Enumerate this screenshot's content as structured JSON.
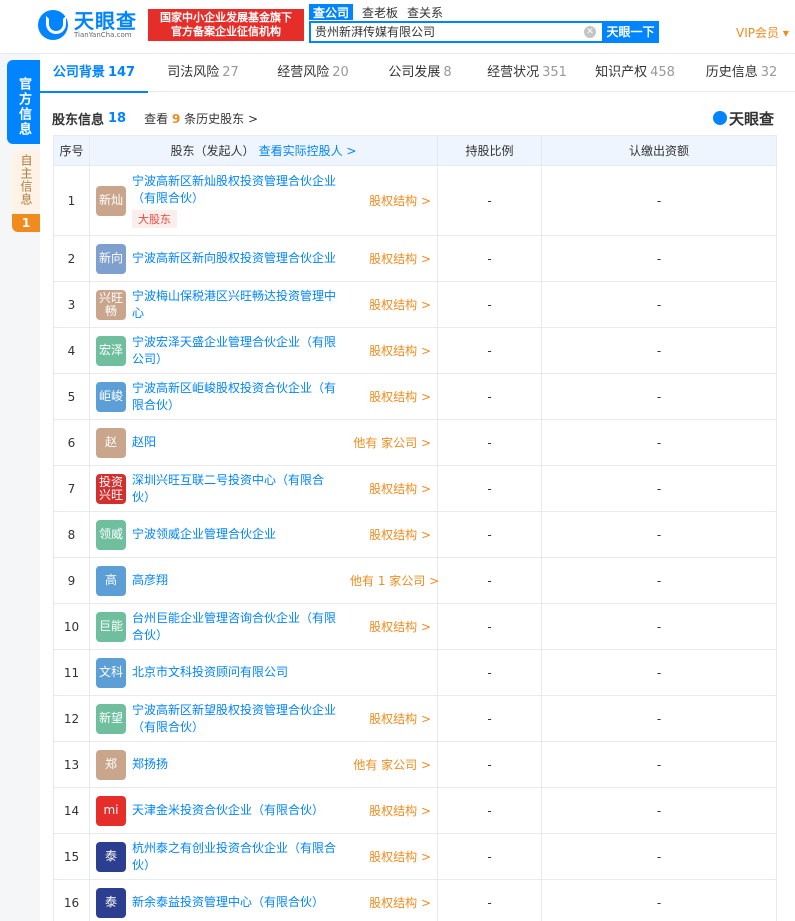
{
  "header": {
    "logo_cn": "天眼查",
    "logo_en": "TianYanCha.com",
    "badge_line1": "国家中小企业发展基金旗下",
    "badge_line2": "官方备案企业征信机构",
    "search_tabs": [
      "查公司",
      "查老板",
      "查关系"
    ],
    "search_value": "贵州新湃传媒有限公司",
    "search_button": "天眼一下",
    "vip": "VIP会员"
  },
  "side_tabs": {
    "official": "官方信息",
    "self": "自主信息",
    "self_count": "1"
  },
  "topnav": [
    {
      "label": "公司背景",
      "count": "147"
    },
    {
      "label": "司法风险",
      "count": "27"
    },
    {
      "label": "经营风险",
      "count": "20"
    },
    {
      "label": "公司发展",
      "count": "8"
    },
    {
      "label": "经营状况",
      "count": "351"
    },
    {
      "label": "知识产权",
      "count": "458"
    },
    {
      "label": "历史信息",
      "count": "32"
    }
  ],
  "section": {
    "title": "股东信息",
    "count": "18",
    "hist_prefix": "查看",
    "hist_count": "9",
    "hist_suffix": "条历史股东 >",
    "brand": "天眼查"
  },
  "table": {
    "headers": {
      "idx": "序号",
      "name": "股东（发起人）",
      "name_link": "查看实际控股人 >",
      "ratio": "持股比例",
      "money": "认缴出资额"
    },
    "rows": [
      {
        "idx": "1",
        "avatar": "新灿",
        "color": "#c9a58c",
        "name": "宁波高新区新灿股权投资管理合伙企业（有限合伙）",
        "tag": "大股东",
        "side": "股权结构 >",
        "ratio": "-",
        "money": "-"
      },
      {
        "idx": "2",
        "avatar": "新向",
        "color": "#7f9fcf",
        "name": "宁波高新区新向股权投资管理合伙企业",
        "side": "股权结构 >",
        "ratio": "-",
        "money": "-"
      },
      {
        "idx": "3",
        "avatar": "兴旺畅",
        "color": "#c9a58c",
        "name": "宁波梅山保税港区兴旺畅达投资管理中心",
        "side": "股权结构 >",
        "ratio": "-",
        "money": "-"
      },
      {
        "idx": "4",
        "avatar": "宏泽",
        "color": "#6fbf9f",
        "name": "宁波宏泽天盛企业管理合伙企业（有限公司）",
        "side": "股权结构 >",
        "ratio": "-",
        "money": "-"
      },
      {
        "idx": "5",
        "avatar": "岠峻",
        "color": "#5c9fd6",
        "name": "宁波高新区岠峻股权投资合伙企业（有限合伙）",
        "side": "股权结构 >",
        "ratio": "-",
        "money": "-"
      },
      {
        "idx": "6",
        "avatar": "赵",
        "color": "#c9a58c",
        "name": "赵阳",
        "side": "他有 家公司 >",
        "ratio": "-",
        "money": "-"
      },
      {
        "idx": "7",
        "avatar": "投资兴旺",
        "color": "#d32f2f",
        "name": "深圳兴旺互联二号投资中心（有限合伙）",
        "side": "股权结构 >",
        "ratio": "-",
        "money": "-"
      },
      {
        "idx": "8",
        "avatar": "领威",
        "color": "#6fbf9f",
        "name": "宁波领威企业管理合伙企业",
        "side": "股权结构 >",
        "ratio": "-",
        "money": "-"
      },
      {
        "idx": "9",
        "avatar": "高",
        "color": "#5c9fd6",
        "name": "高彦翔",
        "side": "他有 1 家公司 >",
        "ratio": "-",
        "money": "-"
      },
      {
        "idx": "10",
        "avatar": "巨能",
        "color": "#6fbf9f",
        "name": "台州巨能企业管理咨询合伙企业（有限合伙）",
        "side": "股权结构 >",
        "ratio": "-",
        "money": "-"
      },
      {
        "idx": "11",
        "avatar": "文科",
        "color": "#5c9fd6",
        "name": "北京市文科投资顾问有限公司",
        "side": "",
        "ratio": "-",
        "money": "-"
      },
      {
        "idx": "12",
        "avatar": "新望",
        "color": "#6fbf9f",
        "name": "宁波高新区新望股权投资管理合伙企业（有限合伙）",
        "side": "股权结构 >",
        "ratio": "-",
        "money": "-"
      },
      {
        "idx": "13",
        "avatar": "郑",
        "color": "#c9a58c",
        "name": "郑扬扬",
        "side": "他有 家公司 >",
        "ratio": "-",
        "money": "-"
      },
      {
        "idx": "14",
        "avatar": "mi",
        "color": "#e52d2a",
        "name": "天津金米投资合伙企业（有限合伙）",
        "side": "股权结构 >",
        "ratio": "-",
        "money": "-"
      },
      {
        "idx": "15",
        "avatar": "泰",
        "color": "#2c3e8f",
        "name": "杭州泰之有创业投资合伙企业（有限合伙）",
        "side": "股权结构 >",
        "ratio": "-",
        "money": "-"
      },
      {
        "idx": "16",
        "avatar": "泰",
        "color": "#2c3e8f",
        "name": "新余泰益投资管理中心（有限合伙）",
        "side": "股权结构 >",
        "ratio": "-",
        "money": "-"
      }
    ]
  }
}
